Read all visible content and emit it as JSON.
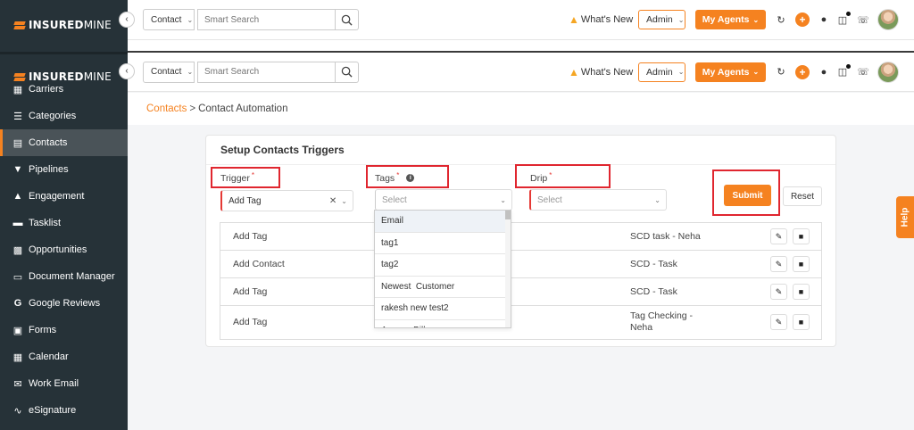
{
  "brand": {
    "name_bold": "INSURED",
    "name_light": "MINE",
    "accent": "#f58220",
    "sidebar_bg": "#263238"
  },
  "sidebar": {
    "items": [
      {
        "label": "Carriers",
        "icon": "carriers-icon"
      },
      {
        "label": "Categories",
        "icon": "list-icon"
      },
      {
        "label": "Contacts",
        "icon": "contacts-icon",
        "active": true
      },
      {
        "label": "Pipelines",
        "icon": "funnel-icon"
      },
      {
        "label": "Engagement",
        "icon": "megaphone-icon"
      },
      {
        "label": "Tasklist",
        "icon": "tasklist-icon"
      },
      {
        "label": "Opportunities",
        "icon": "bar-chart-icon"
      },
      {
        "label": "Document Manager",
        "icon": "folder-icon"
      },
      {
        "label": "Google Reviews",
        "icon": "google-icon"
      },
      {
        "label": "Forms",
        "icon": "forms-icon"
      },
      {
        "label": "Calendar",
        "icon": "calendar-icon"
      },
      {
        "label": "Work Email",
        "icon": "email-icon"
      },
      {
        "label": "eSignature",
        "icon": "signature-icon"
      }
    ]
  },
  "header": {
    "contact_select": "Contact",
    "search_placeholder": "Smart Search",
    "whats_new": "What's New",
    "admin_select": "Admin",
    "agents_button": "My Agents"
  },
  "breadcrumb": {
    "parent": "Contacts",
    "separator": ">",
    "current": "Contact Automation"
  },
  "form": {
    "title": "Setup Contacts Triggers",
    "trigger_label": "Trigger",
    "trigger_value": "Add Tag",
    "tags_label": "Tags",
    "tags_placeholder": "Select",
    "drip_label": "Drip",
    "drip_placeholder": "Select",
    "submit_label": "Submit",
    "reset_label": "Reset",
    "required_mark": "*"
  },
  "tags_dropdown": {
    "options": [
      "Email",
      "tag1",
      "tag2",
      "Newest  Customer",
      "rakesh new test2",
      "Agency Bill"
    ]
  },
  "table": {
    "rows": [
      {
        "trigger": "Add Tag",
        "drip": "SCD task - Neha"
      },
      {
        "trigger": "Add Contact",
        "drip": "SCD - Task"
      },
      {
        "trigger": "Add Tag",
        "drip": "SCD - Task"
      },
      {
        "trigger": "Add Tag",
        "drip": "Tag Checking - Neha"
      }
    ]
  },
  "help_tab": {
    "label": "Help"
  }
}
